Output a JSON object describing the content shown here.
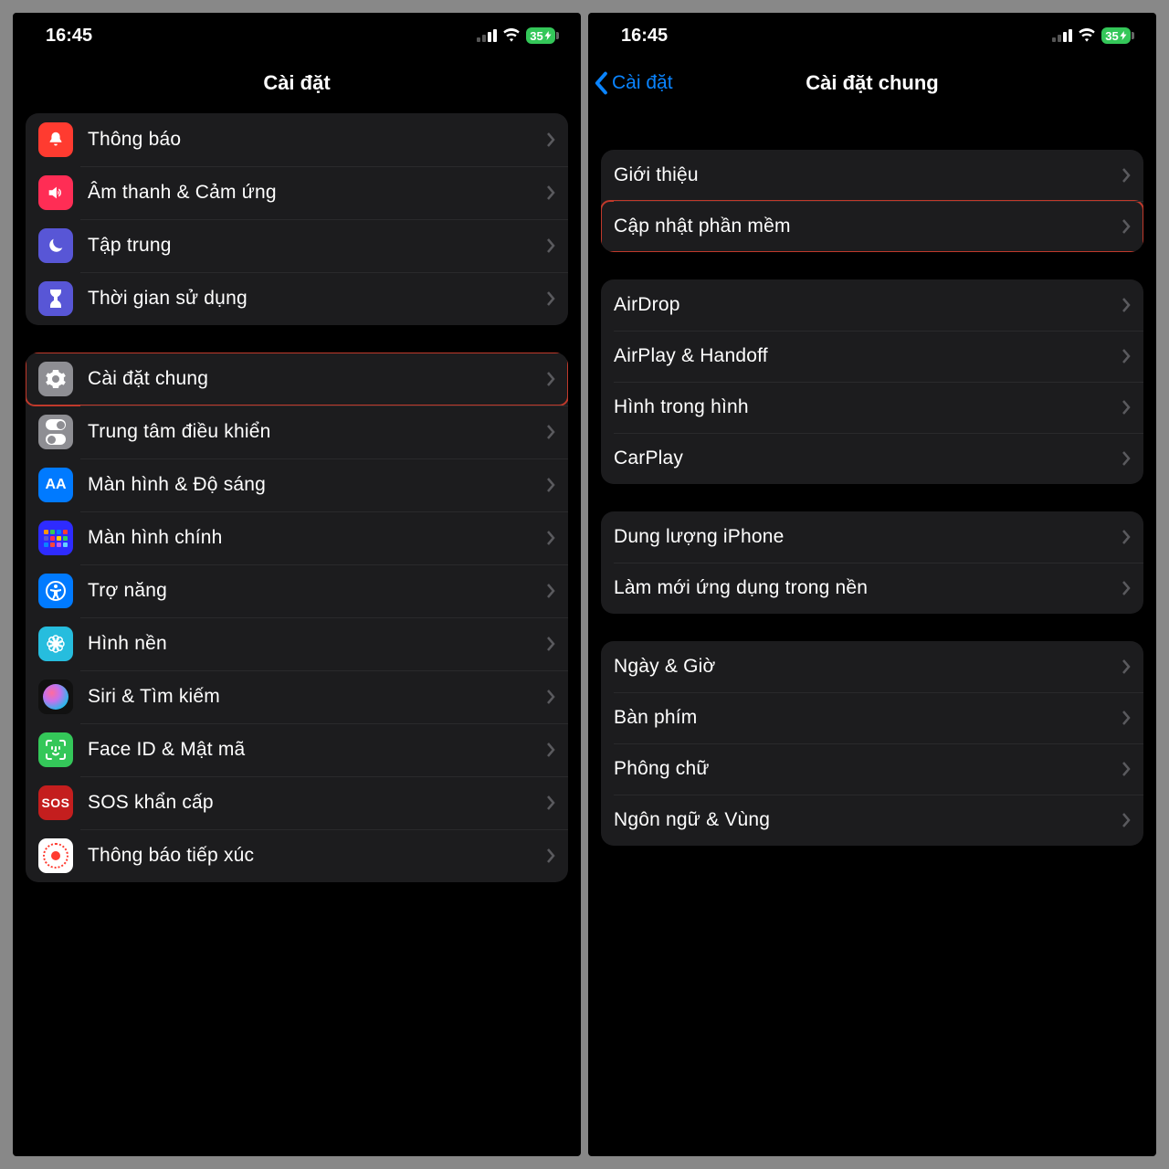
{
  "status": {
    "time": "16:45",
    "battery_percent": "35"
  },
  "left": {
    "title": "Cài đặt",
    "group1": [
      {
        "label": "Thông báo"
      },
      {
        "label": "Âm thanh & Cảm ứng"
      },
      {
        "label": "Tập trung"
      },
      {
        "label": "Thời gian sử dụng"
      }
    ],
    "group2": [
      {
        "label": "Cài đặt chung"
      },
      {
        "label": "Trung tâm điều khiển"
      },
      {
        "label": "Màn hình & Độ sáng"
      },
      {
        "label": "Màn hình chính"
      },
      {
        "label": "Trợ năng"
      },
      {
        "label": "Hình nền"
      },
      {
        "label": "Siri & Tìm kiếm"
      },
      {
        "label": "Face ID & Mật mã"
      },
      {
        "label": "SOS khẩn cấp"
      },
      {
        "label": "Thông báo tiếp xúc"
      }
    ],
    "sos_text": "SOS"
  },
  "right": {
    "back_label": "Cài đặt",
    "title": "Cài đặt chung",
    "group1": [
      {
        "label": "Giới thiệu"
      },
      {
        "label": "Cập nhật phần mềm"
      }
    ],
    "group2": [
      {
        "label": "AirDrop"
      },
      {
        "label": "AirPlay & Handoff"
      },
      {
        "label": "Hình trong hình"
      },
      {
        "label": "CarPlay"
      }
    ],
    "group3": [
      {
        "label": "Dung lượng iPhone"
      },
      {
        "label": "Làm mới ứng dụng trong nền"
      }
    ],
    "group4": [
      {
        "label": "Ngày & Giờ"
      },
      {
        "label": "Bàn phím"
      },
      {
        "label": "Phông chữ"
      },
      {
        "label": "Ngôn ngữ & Vùng"
      }
    ]
  },
  "icon_text": {
    "AA": "AA"
  }
}
